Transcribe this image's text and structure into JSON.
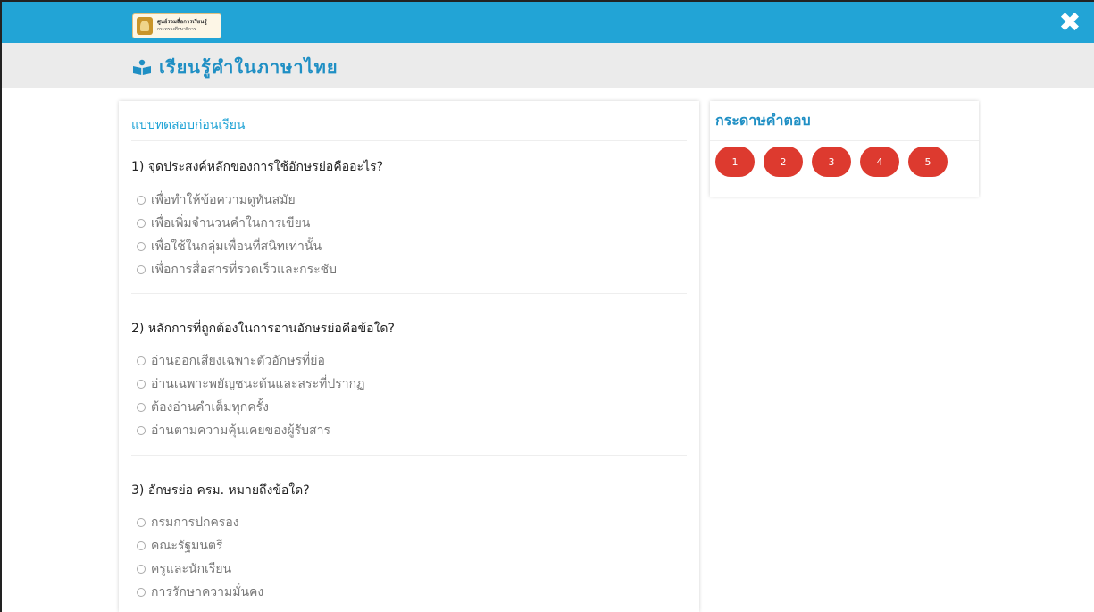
{
  "header": {
    "logo_line1": "ศูนย์รวมสื่อการเรียนรู้",
    "logo_line2": "กระทรวงศึกษาธิการ",
    "close_icon": "✖",
    "page_title": "เรียนรู้คำในภาษาไทย"
  },
  "quiz": {
    "title": "แบบทดสอบก่อนเรียน",
    "questions": [
      {
        "text": "1) จุดประสงค์หลักของการใช้อักษรย่อคืออะไร?",
        "options": [
          "เพื่อทำให้ข้อความดูทันสมัย",
          "เพื่อเพิ่มจำนวนคำในการเขียน",
          "เพื่อใช้ในกลุ่มเพื่อนที่สนิทเท่านั้น",
          "เพื่อการสื่อสารที่รวดเร็วและกระชับ"
        ]
      },
      {
        "text": "2) หลักการที่ถูกต้องในการอ่านอักษรย่อคือข้อใด?",
        "options": [
          "อ่านออกเสียงเฉพาะตัวอักษรที่ย่อ",
          "อ่านเฉพาะพยัญชนะต้นและสระที่ปรากฏ",
          "ต้องอ่านคำเต็มทุกครั้ง",
          "อ่านตามความคุ้นเคยของผู้รับสาร"
        ]
      },
      {
        "text": "3) อักษรย่อ ครม. หมายถึงข้อใด?",
        "options": [
          "กรมการปกครอง",
          "คณะรัฐมนตรี",
          "ครูและนักเรียน",
          "การรักษาความมั่นคง"
        ]
      }
    ]
  },
  "answer_sheet": {
    "title": "กระดาษคำตอบ",
    "buttons": [
      "1",
      "2",
      "3",
      "4",
      "5"
    ],
    "button_color": "#dd3a2f"
  },
  "colors": {
    "topbar": "#22a4d6",
    "accent": "#1f8fc4"
  }
}
